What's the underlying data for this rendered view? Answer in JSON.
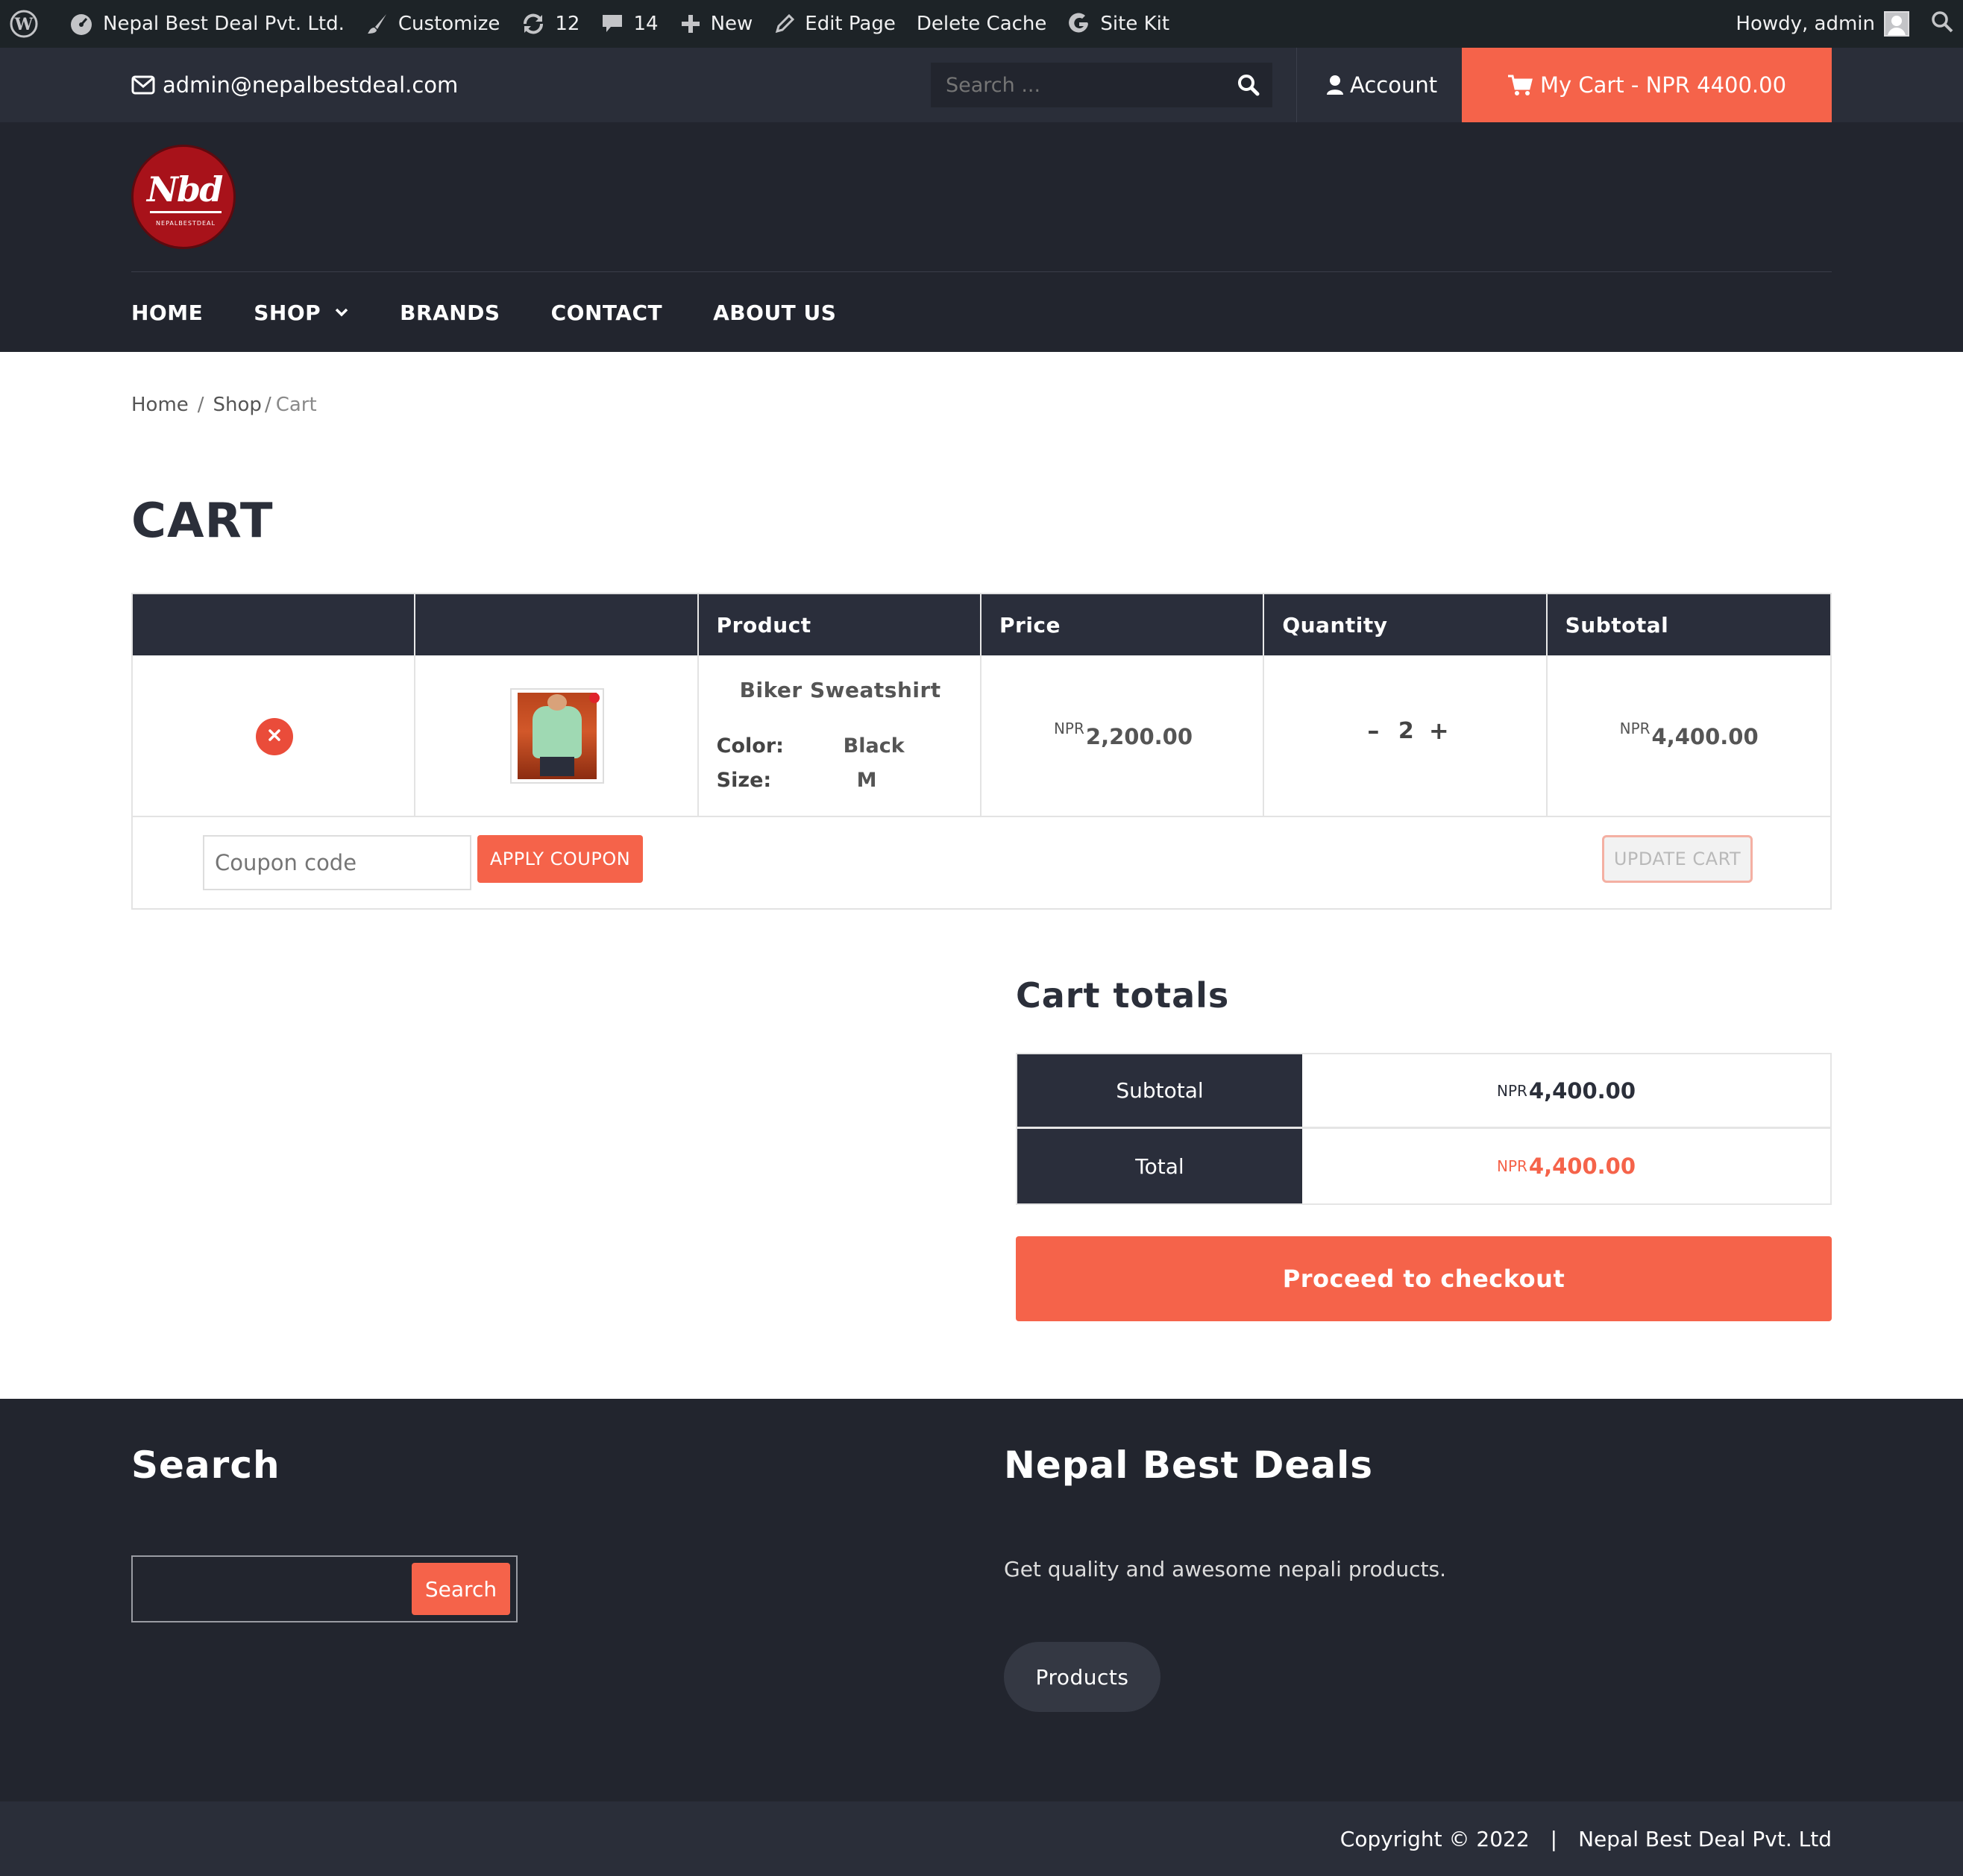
{
  "admin_bar": {
    "site_name": "Nepal Best Deal Pvt. Ltd.",
    "customize": "Customize",
    "updates_count": "12",
    "comments_count": "14",
    "new": "New",
    "edit_page": "Edit Page",
    "delete_cache": "Delete Cache",
    "site_kit": "Site Kit",
    "howdy": "Howdy, admin"
  },
  "topbar": {
    "email": "admin@nepalbestdeal.com",
    "search_placeholder": "Search ...",
    "account": "Account",
    "my_cart": "My Cart - NPR 4400.00"
  },
  "logo": {
    "text": "Nbd",
    "subtext": "NEPALBESTDEAL"
  },
  "nav": {
    "home": "HOME",
    "shop": "SHOP",
    "brands": "BRANDS",
    "contact": "CONTACT",
    "about": "ABOUT US"
  },
  "breadcrumb": {
    "home": "Home",
    "sep1": "/",
    "shop": "Shop",
    "sep2": "/",
    "current": "Cart"
  },
  "page_title": "CART",
  "cart_table": {
    "headers": [
      "",
      "",
      "Product",
      "Price",
      "Quantity",
      "Subtotal"
    ],
    "items": [
      {
        "name": "Biker Sweatshirt",
        "color_label": "Color:",
        "color_value": "Black",
        "size_label": "Size:",
        "size_value": "M",
        "currency": "NPR",
        "price": "2,200.00",
        "quantity": "2",
        "minus": "–",
        "plus": "+",
        "subtotal": "4,400.00"
      }
    ],
    "coupon_placeholder": "Coupon code",
    "apply_coupon": "APPLY COUPON",
    "update_cart": "UPDATE CART"
  },
  "cart_totals": {
    "title": "Cart totals",
    "subtotal_label": "Subtotal",
    "subtotal_currency": "NPR",
    "subtotal_value": "4,400.00",
    "total_label": "Total",
    "total_currency": "NPR",
    "total_value": "4,400.00",
    "checkout": "Proceed to checkout"
  },
  "footer": {
    "search_title": "Search",
    "search_button": "Search",
    "about_title": "Nepal Best Deals",
    "about_text": "Get quality and awesome nepali products.",
    "products_button": "Products",
    "copyright": "Copyright © 2022",
    "separator": "|",
    "company": "Nepal Best Deal Pvt. Ltd"
  },
  "colors": {
    "accent": "#f5634a",
    "dark": "#22252e",
    "header_table": "#2a2e3b"
  }
}
